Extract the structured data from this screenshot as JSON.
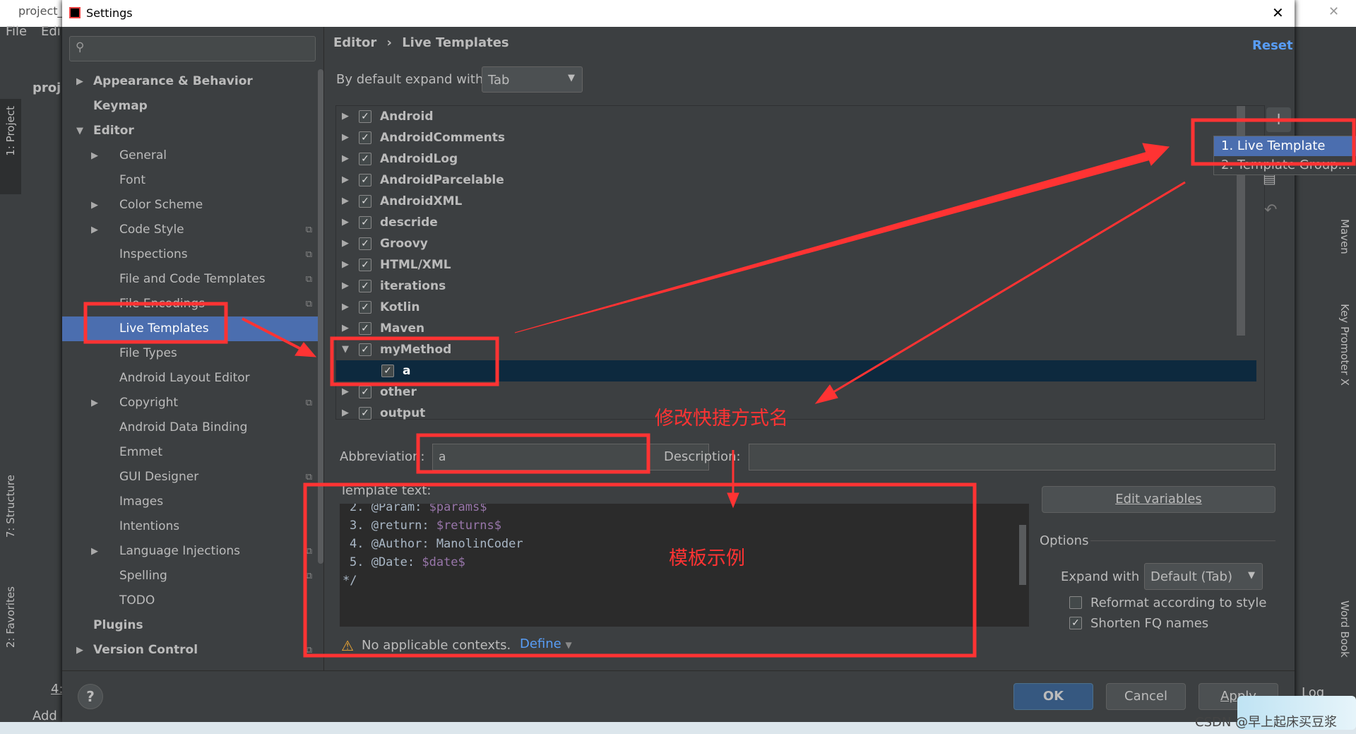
{
  "ide": {
    "project_tab": "project_",
    "menu": [
      "File",
      "Edi"
    ],
    "project_label": "proj",
    "left_tools": [
      "1: Project",
      "7: Structure",
      "2: Favorites"
    ],
    "right_tools": [
      "Maven",
      "Key Promoter X",
      "Word Book"
    ],
    "bottom_add": "Add",
    "bottom_tool": "4:",
    "log": "Log"
  },
  "dialog": {
    "title": "Settings",
    "close": "✕"
  },
  "search": {
    "placeholder": ""
  },
  "sidebar": {
    "items": [
      {
        "label": "Appearance & Behavior",
        "level": 0,
        "arrow": "▶",
        "bold": true
      },
      {
        "label": "Keymap",
        "level": 0,
        "bold": true
      },
      {
        "label": "Editor",
        "level": 0,
        "arrow": "▼",
        "bold": true
      },
      {
        "label": "General",
        "level": 1,
        "arrow": "▶"
      },
      {
        "label": "Font",
        "level": 1
      },
      {
        "label": "Color Scheme",
        "level": 1,
        "arrow": "▶"
      },
      {
        "label": "Code Style",
        "level": 1,
        "arrow": "▶",
        "copy": true
      },
      {
        "label": "Inspections",
        "level": 1,
        "copy": true
      },
      {
        "label": "File and Code Templates",
        "level": 1,
        "copy": true
      },
      {
        "label": "File Encodings",
        "level": 1,
        "copy": true
      },
      {
        "label": "Live Templates",
        "level": 1,
        "selected": true
      },
      {
        "label": "File Types",
        "level": 1
      },
      {
        "label": "Android Layout Editor",
        "level": 1
      },
      {
        "label": "Copyright",
        "level": 1,
        "arrow": "▶",
        "copy": true
      },
      {
        "label": "Android Data Binding",
        "level": 1
      },
      {
        "label": "Emmet",
        "level": 1
      },
      {
        "label": "GUI Designer",
        "level": 1,
        "copy": true
      },
      {
        "label": "Images",
        "level": 1
      },
      {
        "label": "Intentions",
        "level": 1
      },
      {
        "label": "Language Injections",
        "level": 1,
        "arrow": "▶",
        "copy": true
      },
      {
        "label": "Spelling",
        "level": 1,
        "copy": true
      },
      {
        "label": "TODO",
        "level": 1
      },
      {
        "label": "Plugins",
        "level": 0,
        "bold": true
      },
      {
        "label": "Version Control",
        "level": 0,
        "arrow": "▶",
        "bold": true,
        "copy": true
      }
    ]
  },
  "breadcrumb": {
    "parent": "Editor",
    "sep": "›",
    "current": "Live Templates",
    "reset": "Reset"
  },
  "expand_default": {
    "label": "By default expand with",
    "value": "Tab"
  },
  "templates": {
    "groups": [
      {
        "label": "Android",
        "checked": true
      },
      {
        "label": "AndroidComments",
        "checked": true
      },
      {
        "label": "AndroidLog",
        "checked": true
      },
      {
        "label": "AndroidParcelable",
        "checked": true
      },
      {
        "label": "AndroidXML",
        "checked": true
      },
      {
        "label": "descride",
        "checked": true
      },
      {
        "label": "Groovy",
        "checked": true
      },
      {
        "label": "HTML/XML",
        "checked": true
      },
      {
        "label": "iterations",
        "checked": true
      },
      {
        "label": "Kotlin",
        "checked": true
      },
      {
        "label": "Maven",
        "checked": true
      },
      {
        "label": "myMethod",
        "checked": true,
        "expanded": true
      },
      {
        "label": "a",
        "checked": true,
        "child": true,
        "selected": true
      },
      {
        "label": "other",
        "checked": true
      },
      {
        "label": "output",
        "checked": true
      }
    ]
  },
  "add_menu": {
    "items": [
      "1. Live Template",
      "2. Template Group..."
    ]
  },
  "form": {
    "abbreviation_label": "Abbreviation:",
    "abbreviation_value": "a",
    "description_label": "Description:",
    "description_value": "",
    "template_label": "Template text:",
    "code_lines": [
      [
        "2. @Param: ",
        "$params$"
      ],
      [
        "3. @return: ",
        "$returns$"
      ],
      [
        "4. @Author: ManolinCoder",
        ""
      ],
      [
        "5. @Date: ",
        "$date$"
      ],
      [
        "*/",
        ""
      ]
    ],
    "edit_variables": "Edit variables",
    "options_label": "Options",
    "expand_with_label": "Expand with",
    "expand_with_value": "Default (Tab)",
    "reformat_label": "Reformat according to style",
    "reformat_checked": false,
    "shorten_label": "Shorten FQ names",
    "shorten_checked": true,
    "warning": "No applicable contexts.",
    "define": "Define"
  },
  "footer": {
    "help": "?",
    "ok": "OK",
    "cancel": "Cancel",
    "apply": "Apply"
  },
  "annotations": {
    "rename_note": "修改快捷方式名",
    "template_note": "模板示例",
    "color": "#ff3333"
  },
  "watermark": "CSDN @早上起床买豆浆"
}
